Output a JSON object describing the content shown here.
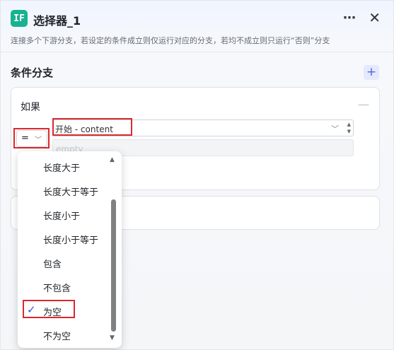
{
  "header": {
    "icon_text": "IF",
    "title": "选择器_1",
    "more_icon": "more-horizontal-icon",
    "close_icon": "close-icon"
  },
  "description": "连接多个下游分支，若设定的条件成立则仅运行对应的分支，若均不成立则只运行“否则”分支",
  "section": {
    "title": "条件分支",
    "add_icon": "plus-icon"
  },
  "branch": {
    "label": "如果",
    "collapse_icon": "minus-icon",
    "operator": "=",
    "variable": "开始 - content",
    "value_placeholder": "empty"
  },
  "dropdown": {
    "options": [
      "长度大于",
      "长度大于等于",
      "长度小于",
      "长度小于等于",
      "包含",
      "不包含",
      "为空",
      "不为空"
    ],
    "selected": "为空"
  },
  "colors": {
    "accent": "#3a4be0",
    "node_icon": "#17b290",
    "highlight": "#d9292f"
  }
}
